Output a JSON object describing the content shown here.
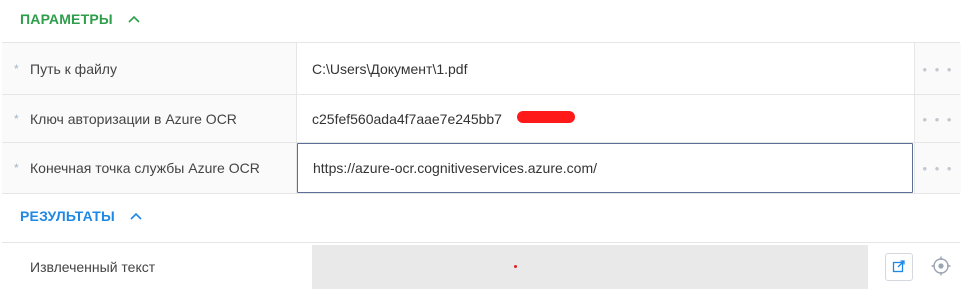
{
  "parameters": {
    "title": "ПАРАМЕТРЫ",
    "rows": [
      {
        "label": "Путь к файлу",
        "value": "C:\\Users\\Документ\\1.pdf"
      },
      {
        "label": "Ключ авторизации в Azure OCR",
        "value": "c25fef560ada4f7aae7e245bb7"
      },
      {
        "label": "Конечная точка службы Azure OCR",
        "value": "https://azure-ocr.cognitiveservices.azure.com/"
      }
    ],
    "required_marker": "*",
    "more_label": "• • •"
  },
  "results": {
    "title": "РЕЗУЛЬТАТЫ",
    "rows": [
      {
        "label": "Извлеченный текст",
        "value": ""
      }
    ]
  },
  "colors": {
    "params_accent": "#2e9e4a",
    "results_accent": "#1e88e5",
    "redaction": "#ff1a1a"
  },
  "icons": [
    "chevron-up-icon",
    "output-variable-icon",
    "target-icon"
  ]
}
